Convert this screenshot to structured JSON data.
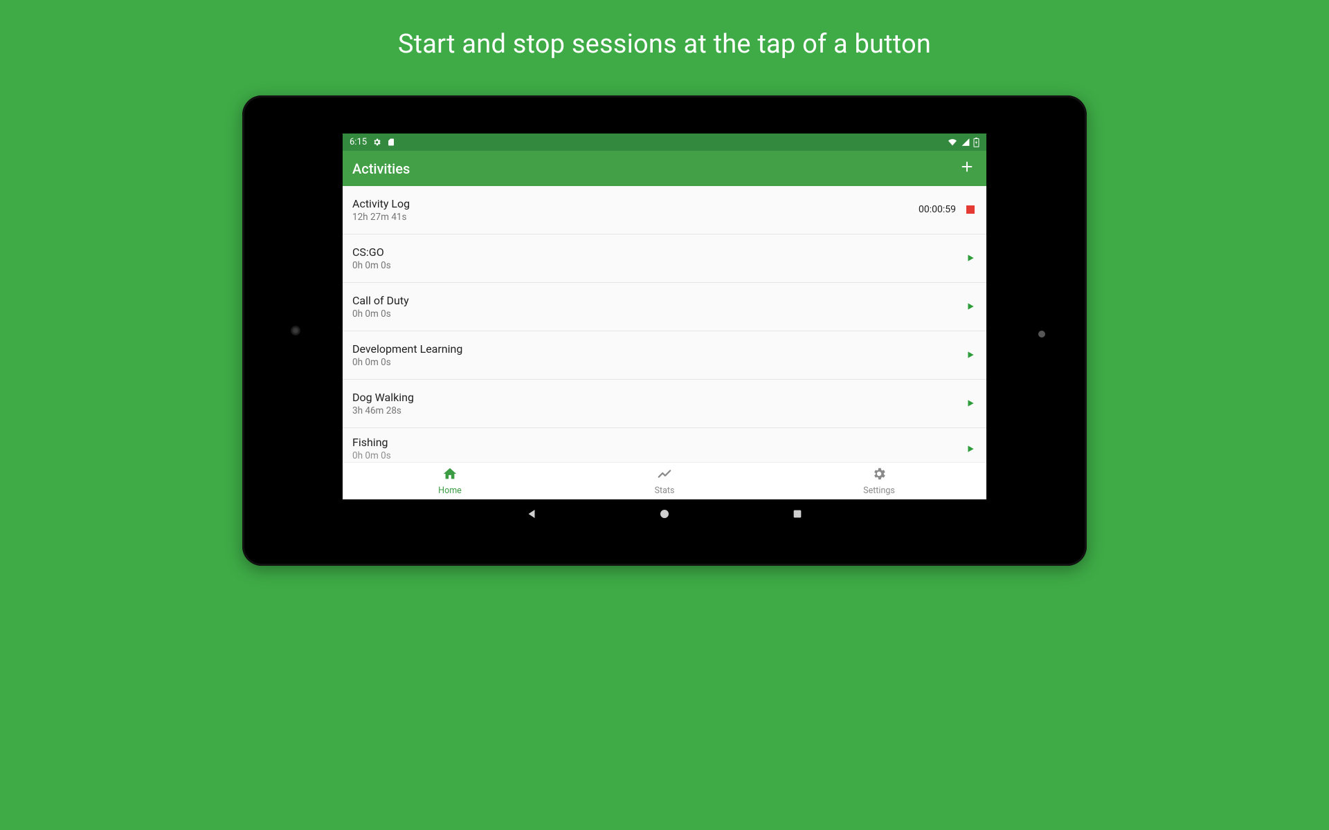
{
  "headline": "Start and stop sessions at the tap of a button",
  "statusbar": {
    "time": "6:15"
  },
  "appbar": {
    "title": "Activities"
  },
  "activities": [
    {
      "name": "Activity Log",
      "duration": "12h 27m 41s",
      "running": true,
      "timer": "00:00:59"
    },
    {
      "name": "CS:GO",
      "duration": "0h 0m 0s",
      "running": false
    },
    {
      "name": "Call of Duty",
      "duration": "0h 0m 0s",
      "running": false
    },
    {
      "name": "Development Learning",
      "duration": "0h 0m 0s",
      "running": false
    },
    {
      "name": "Dog Walking",
      "duration": "3h 46m 28s",
      "running": false
    },
    {
      "name": "Fishing",
      "duration": "0h 0m 0s",
      "running": false
    }
  ],
  "bottomnav": {
    "home": "Home",
    "stats": "Stats",
    "settings": "Settings",
    "active": "home"
  }
}
